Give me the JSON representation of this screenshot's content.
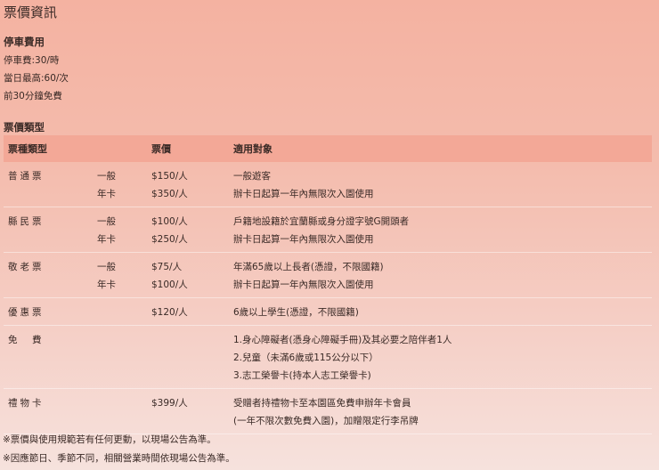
{
  "title": "票價資訊",
  "parking": {
    "heading": "停車費用",
    "lines": [
      "停車費:30/時",
      "當日最高:60/次",
      "前30分鐘免費"
    ]
  },
  "ticket_types_heading": "票價類型",
  "table": {
    "headers": [
      "票種類型",
      "票價",
      "適用對象"
    ],
    "groups": [
      {
        "type": "普通票",
        "rows": [
          {
            "sub": "一般",
            "price": "$150/人",
            "target": "一般遊客"
          },
          {
            "sub": "年卡",
            "price": "$350/人",
            "target": "辦卡日起算一年內無限次入園使用"
          }
        ]
      },
      {
        "type": "縣民票",
        "rows": [
          {
            "sub": "一般",
            "price": "$100/人",
            "target": "戶籍地設籍於宜蘭縣或身分證字號G開頭者"
          },
          {
            "sub": "年卡",
            "price": "$250/人",
            "target": "辦卡日起算一年內無限次入園使用"
          }
        ]
      },
      {
        "type": "敬老票",
        "rows": [
          {
            "sub": "一般",
            "price": "$75/人",
            "target": "年滿65歲以上長者(憑證，不限國籍)"
          },
          {
            "sub": "年卡",
            "price": "$100/人",
            "target": "辦卡日起算一年內無限次入園使用"
          }
        ]
      },
      {
        "type": "優惠票",
        "rows": [
          {
            "sub": "",
            "price": "$120/人",
            "target": "6歲以上學生(憑證，不限國籍)"
          }
        ]
      },
      {
        "type": "免　費",
        "rows": [
          {
            "sub": "",
            "price": "",
            "target": "1.身心障礙者(憑身心障礙手冊)及其必要之陪伴者1人"
          },
          {
            "sub": "",
            "price": "",
            "target": "2.兒童（未滿6歲或115公分以下）"
          },
          {
            "sub": "",
            "price": "",
            "target": "3.志工榮譽卡(持本人志工榮譽卡)"
          }
        ]
      },
      {
        "type": "禮物卡",
        "rows": [
          {
            "sub": "",
            "price": "$399/人",
            "target": "受贈者持禮物卡至本園區免費申辦年卡會員"
          },
          {
            "sub": "",
            "price": "",
            "target": "(一年不限次數免費入園)，加贈限定行李吊牌"
          }
        ]
      }
    ]
  },
  "notes": [
    "※票價與使用規範若有任何更動，以現場公告為準。",
    "※因應節日、季節不同，相關營業時間依現場公告為準。"
  ]
}
